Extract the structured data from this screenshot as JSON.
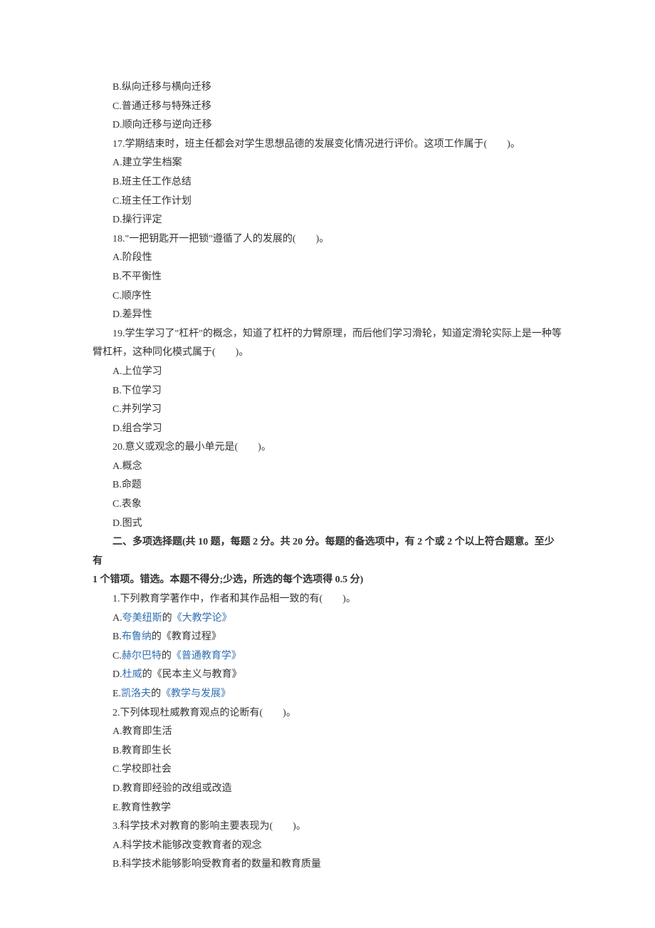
{
  "q16": {
    "optB": "B.纵向迁移与横向迁移",
    "optC": "C.普通迁移与特殊迁移",
    "optD": "D.顺向迁移与逆向迁移"
  },
  "q17": {
    "stem": "17.学期结束时，班主任都会对学生思想品德的发展变化情况进行评价。这项工作属于(　　)。",
    "optA": "A.建立学生档案",
    "optB": "B.班主任工作总结",
    "optC": "C.班主任工作计划",
    "optD": "D.操行评定"
  },
  "q18": {
    "stem": "18.\"一把钥匙开一把锁\"遵循了人的发展的(　　)。",
    "optA": "A.阶段性",
    "optB": "B.不平衡性",
    "optC": "C.顺序性",
    "optD": "D.差异性"
  },
  "q19": {
    "stem1": "19.学生学习了\"杠杆\"的概念，知道了杠杆的力臂原理，而后他们学习滑轮，知道定滑轮实际上是一种等",
    "stem2": "臂杠杆，这种同化模式属于(　　)。",
    "optA": "A.上位学习",
    "optB": "B.下位学习",
    "optC": "C.并列学习",
    "optD": "D.组合学习"
  },
  "q20": {
    "stem": "20.意义或观念的最小单元是(　　)。",
    "optA": "A.概念",
    "optB": "B.命题",
    "optC": "C.表象",
    "optD": "D.图式"
  },
  "section2": {
    "title1": "二、多项选择题(共 10 题，每题 2 分。共 20 分。每题的备选项中，有 2 个或 2 个以上符合题意。至少有",
    "title2": "1 个错项。错选。本题不得分;少选，所选的每个选项得 0.5 分)"
  },
  "m1": {
    "stem": "1.下列教育学著作中，作者和其作品相一致的有(　　)。",
    "optA_pre": "A.",
    "optA_link1": "夸美纽斯",
    "optA_mid": "的",
    "optA_link2": "《大教学论》",
    "optB_pre": "B.",
    "optB_link1": "布鲁纳",
    "optB_mid": "的《教育过程》",
    "optC_pre": "C.",
    "optC_link1": "赫尔巴特",
    "optC_mid": "的",
    "optC_link2": "《普通教育学》",
    "optD_pre": "D.",
    "optD_link1": "杜威",
    "optD_mid": "的《民本主义与教育》",
    "optE_pre": "E.",
    "optE_link1": "凯洛夫",
    "optE_mid": "的",
    "optE_link2": "《教学与发展》"
  },
  "m2": {
    "stem": "2.下列体现杜威教育观点的论断有(　　)。",
    "optA": "A.教育即生活",
    "optB": "B.教育即生长",
    "optC": "C.学校即社会",
    "optD": "D.教育即经验的改组或改造",
    "optE": "E.教育性教学"
  },
  "m3": {
    "stem": "3.科学技术对教育的影响主要表现为(　　)。",
    "optA": "A.科学技术能够改变教育者的观念",
    "optB": "B.科学技术能够影响受教育者的数量和教育质量"
  }
}
